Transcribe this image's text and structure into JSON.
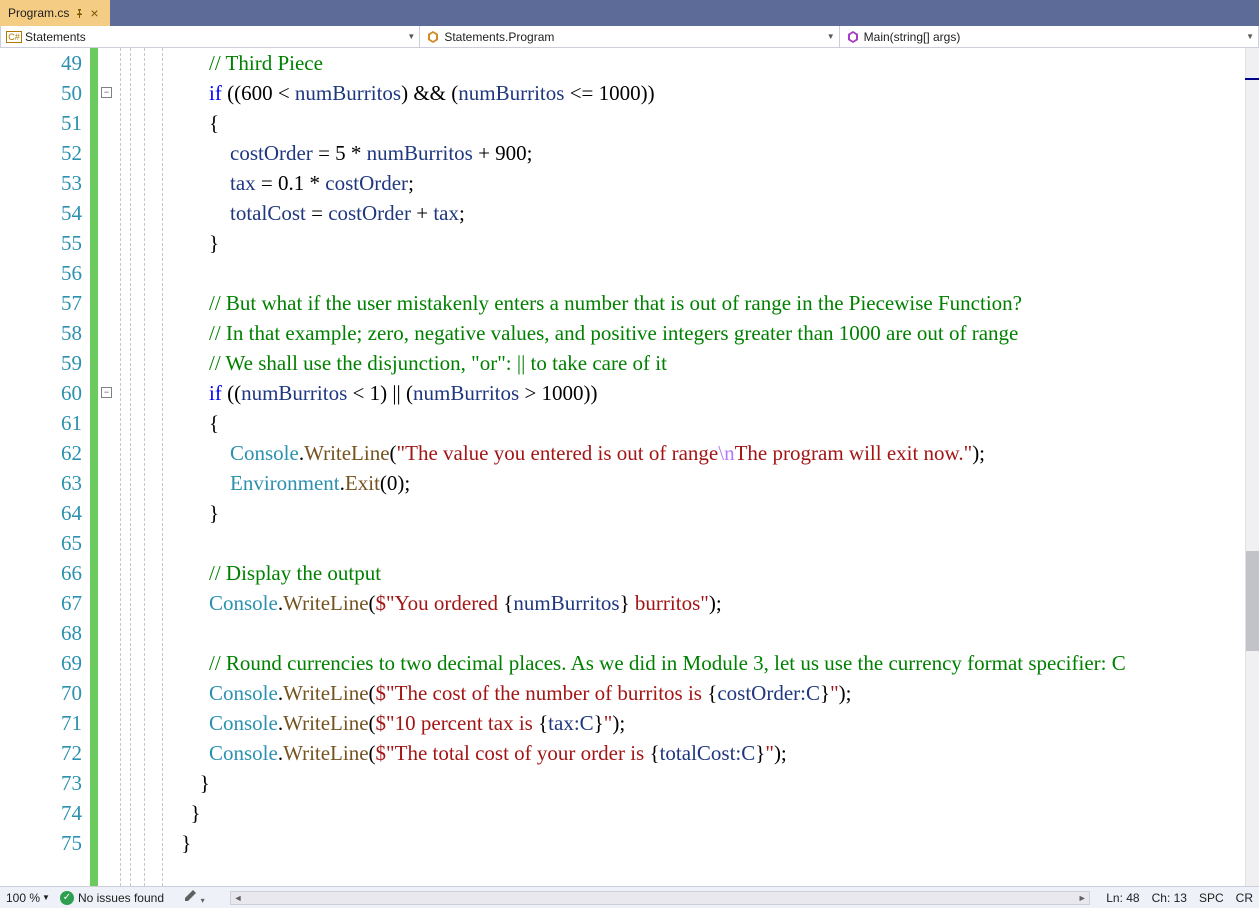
{
  "tab": {
    "title": "Program.cs"
  },
  "nav": {
    "seg1": "Statements",
    "seg2": "Statements.Program",
    "seg3": "Main(string[] args)"
  },
  "lines": [
    {
      "n": 49,
      "html": "<span class='cmnt'>// Third Piece</span>"
    },
    {
      "n": 50,
      "html": "<span class='kw'>if</span> <span class='punc'>((</span><span class='num'>600</span> <span class='op'>&lt;</span> <span class='id'>numBurritos</span><span class='punc'>)</span> <span class='op'>&amp;&amp;</span> <span class='punc'>(</span><span class='id'>numBurritos</span> <span class='op'>&lt;=</span> <span class='num'>1000</span><span class='punc'>))</span>"
    },
    {
      "n": 51,
      "html": "<span class='punc'>{</span>"
    },
    {
      "n": 52,
      "html": "    <span class='id'>costOrder</span> <span class='op'>=</span> <span class='num'>5</span> <span class='op'>*</span> <span class='id'>numBurritos</span> <span class='op'>+</span> <span class='num'>900</span><span class='punc'>;</span>"
    },
    {
      "n": 53,
      "html": "    <span class='id'>tax</span> <span class='op'>=</span> <span class='num'>0.1</span> <span class='op'>*</span> <span class='id'>costOrder</span><span class='punc'>;</span>"
    },
    {
      "n": 54,
      "html": "    <span class='id'>totalCost</span> <span class='op'>=</span> <span class='id'>costOrder</span> <span class='op'>+</span> <span class='id'>tax</span><span class='punc'>;</span>"
    },
    {
      "n": 55,
      "html": "<span class='punc'>}</span>"
    },
    {
      "n": 56,
      "html": ""
    },
    {
      "n": 57,
      "html": "<span class='cmnt'>// But what if the user mistakenly enters a number that is out of range in the Piecewise Function?</span>"
    },
    {
      "n": 58,
      "html": "<span class='cmnt'>// In that example; zero, negative values, and positive integers greater than 1000 are out of range</span>"
    },
    {
      "n": 59,
      "html": "<span class='cmnt'>// We shall use the disjunction, \"or\": || to take care of it</span>"
    },
    {
      "n": 60,
      "html": "<span class='kw'>if</span> <span class='punc'>((</span><span class='id'>numBurritos</span> <span class='op'>&lt;</span> <span class='num'>1</span><span class='punc'>)</span> <span class='op'>||</span> <span class='punc'>(</span><span class='id'>numBurritos</span> <span class='op'>&gt;</span> <span class='num'>1000</span><span class='punc'>))</span>"
    },
    {
      "n": 61,
      "html": "<span class='punc'>{</span>"
    },
    {
      "n": 62,
      "html": "    <span class='typ'>Console</span><span class='punc'>.</span><span class='mth'>WriteLine</span><span class='punc'>(</span><span class='str'>\"The value you entered is out of range</span><span class='esc'>\\n</span><span class='str'>The program will exit now.\"</span><span class='punc'>);</span>"
    },
    {
      "n": 63,
      "html": "    <span class='typ'>Environment</span><span class='punc'>.</span><span class='mth'>Exit</span><span class='punc'>(</span><span class='num'>0</span><span class='punc'>);</span>"
    },
    {
      "n": 64,
      "html": "<span class='punc'>}</span>"
    },
    {
      "n": 65,
      "html": ""
    },
    {
      "n": 66,
      "html": "<span class='cmnt'>// Display the output</span>"
    },
    {
      "n": 67,
      "html": "<span class='typ'>Console</span><span class='punc'>.</span><span class='mth'>WriteLine</span><span class='punc'>(</span><span class='str'>$\"You ordered </span><span class='punc'>{</span><span class='id'>numBurritos</span><span class='punc'>}</span><span class='str'> burritos\"</span><span class='punc'>);</span>"
    },
    {
      "n": 68,
      "html": ""
    },
    {
      "n": 69,
      "html": "<span class='cmnt'>// Round currencies to two decimal places. As we did in Module 3, let us use the currency format specifier: C</span>"
    },
    {
      "n": 70,
      "html": "<span class='typ'>Console</span><span class='punc'>.</span><span class='mth'>WriteLine</span><span class='punc'>(</span><span class='str'>$\"The cost of the number of burritos is </span><span class='punc'>{</span><span class='id'>costOrder</span><span class='txt'>:C</span><span class='punc'>}</span><span class='str'>\"</span><span class='punc'>);</span>"
    },
    {
      "n": 71,
      "html": "<span class='typ'>Console</span><span class='punc'>.</span><span class='mth'>WriteLine</span><span class='punc'>(</span><span class='str'>$\"10 percent tax is </span><span class='punc'>{</span><span class='id'>tax</span><span class='txt'>:C</span><span class='punc'>}</span><span class='str'>\"</span><span class='punc'>);</span>"
    },
    {
      "n": 72,
      "html": "<span class='typ'>Console</span><span class='punc'>.</span><span class='mth'>WriteLine</span><span class='punc'>(</span><span class='str'>$\"The total cost of your order is </span><span class='punc'>{</span><span class='id'>totalCost</span><span class='txt'>:C</span><span class='punc'>}</span><span class='str'>\"</span><span class='punc'>);</span>"
    },
    {
      "n": 73,
      "html": ""
    },
    {
      "n": 74,
      "html": ""
    },
    {
      "n": 75,
      "html": ""
    }
  ],
  "indents": [
    16,
    16,
    16,
    16,
    16,
    16,
    16,
    0,
    16,
    16,
    16,
    16,
    16,
    16,
    16,
    16,
    0,
    16,
    16,
    0,
    16,
    16,
    16,
    16,
    12,
    8,
    4
  ],
  "closers": {
    "73": "}",
    "74": "}",
    "75": "}"
  },
  "status": {
    "zoom": "100 %",
    "issues": "No issues found",
    "ln": "Ln: 48",
    "ch": "Ch: 13",
    "spc": "SPC",
    "cr": "CR"
  }
}
